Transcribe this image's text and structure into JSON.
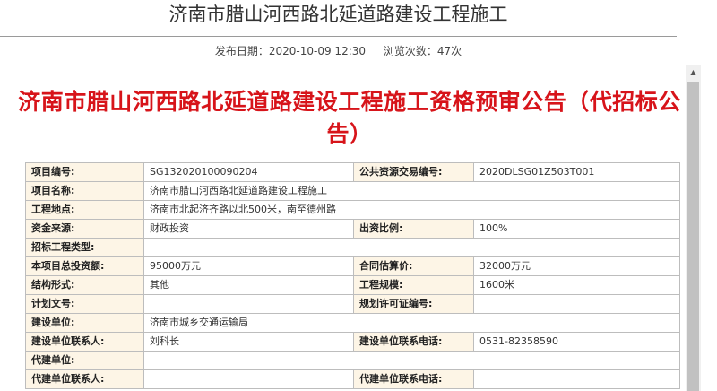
{
  "page_heading": "济南市腊山河西路北延道路建设工程施工",
  "meta": {
    "publish_date": "发布日期：2020-10-09 12:30",
    "views": "浏览次数：47次"
  },
  "doc_title": "济南市腊山河西路北延道路建设工程施工资格预审公告（代招标公告）",
  "table": {
    "rows": [
      {
        "type": "pair",
        "l1": "项目编号:",
        "v1": "SG132020100090204",
        "l2": "公共资源交易编号:",
        "v2": "2020DLSG01Z503T001"
      },
      {
        "type": "wide",
        "l1": "项目名称:",
        "v1": "济南市腊山河西路北延道路建设工程施工"
      },
      {
        "type": "wide",
        "l1": "工程地点:",
        "v1": "济南市北起济齐路以北500米，南至德州路"
      },
      {
        "type": "pair",
        "l1": "资金来源:",
        "v1": "财政投资",
        "l2": "出资比例:",
        "v2": "100%"
      },
      {
        "type": "wide",
        "l1": "招标工程类型:",
        "v1": ""
      },
      {
        "type": "pair",
        "l1": "本项目总投资额:",
        "v1": "95000万元",
        "l2": "合同估算价:",
        "v2": "32000万元"
      },
      {
        "type": "pair",
        "l1": "结构形式:",
        "v1": "其他",
        "l2": "工程规模:",
        "v2": "1600米"
      },
      {
        "type": "pair",
        "l1": "计划文号:",
        "v1": "",
        "l2": "规划许可证编号:",
        "v2": ""
      },
      {
        "type": "wide",
        "l1": "建设单位:",
        "v1": "济南市城乡交通运输局"
      },
      {
        "type": "pair",
        "l1": "建设单位联系人:",
        "v1": "刘科长",
        "l2": "建设单位联系电话:",
        "v2": "0531-82358590"
      },
      {
        "type": "wide",
        "l1": "代建单位:",
        "v1": ""
      },
      {
        "type": "pair",
        "l1": "代建单位联系人:",
        "v1": "",
        "l2": "代建单位联系电话:",
        "v2": ""
      }
    ]
  }
}
